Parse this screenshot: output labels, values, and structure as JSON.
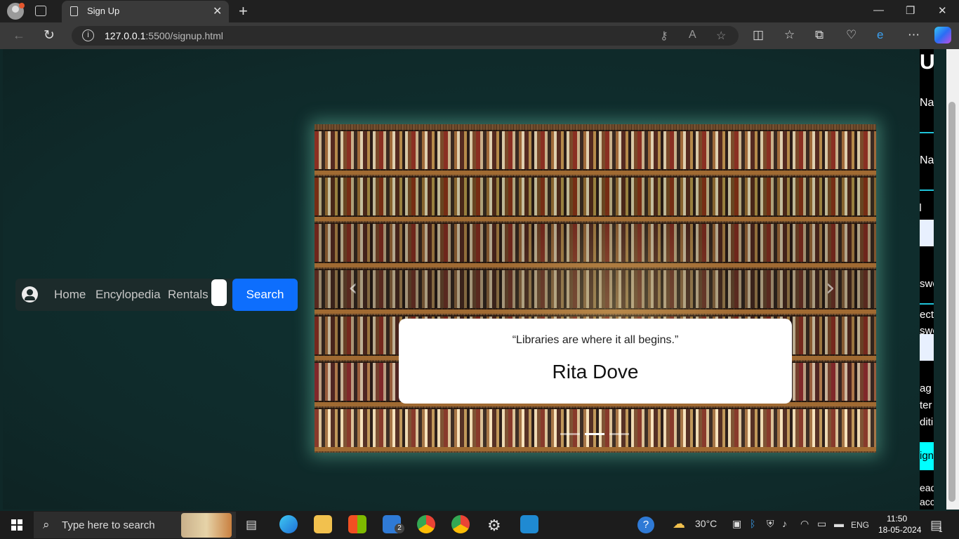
{
  "browser": {
    "tab_title": "Sign Up",
    "tab_close": "✕",
    "new_tab": "+",
    "url_host": "127.0.0.1",
    "url_rest": ":5500/signup.html",
    "window": {
      "minimize": "—",
      "restore": "❐",
      "close": "✕"
    }
  },
  "nav": {
    "links": [
      "Home",
      "Encylopedia",
      "Rentals"
    ],
    "search_value": "",
    "search_button": "Search"
  },
  "carousel": {
    "quote": "“Libraries are where it all begins.”",
    "author": "Rita Dove",
    "prev": "‹",
    "next": "›",
    "indicators": 3,
    "active_indicator": 1
  },
  "form_sliver": {
    "heading": "U",
    "first_name": "Na",
    "last_name": "Na",
    "email": "il",
    "password": "swo",
    "confirm_1": "ect",
    "confirm_2": "swo",
    "terms_1": "ag",
    "terms_2": "ter",
    "terms_3": "diti",
    "button": "ign",
    "already_1": "ead",
    "already_2": "acc"
  },
  "taskbar": {
    "search_placeholder": "Type here to search",
    "weather": "30°C",
    "language": "ENG",
    "time": "11:50",
    "date": "18-05-2024",
    "mail_badge": "2",
    "notification_badge": "1"
  },
  "colors": {
    "page_bg": "#0f2828",
    "search_button": "#0d6efd",
    "form_accent": "#00ffff"
  }
}
